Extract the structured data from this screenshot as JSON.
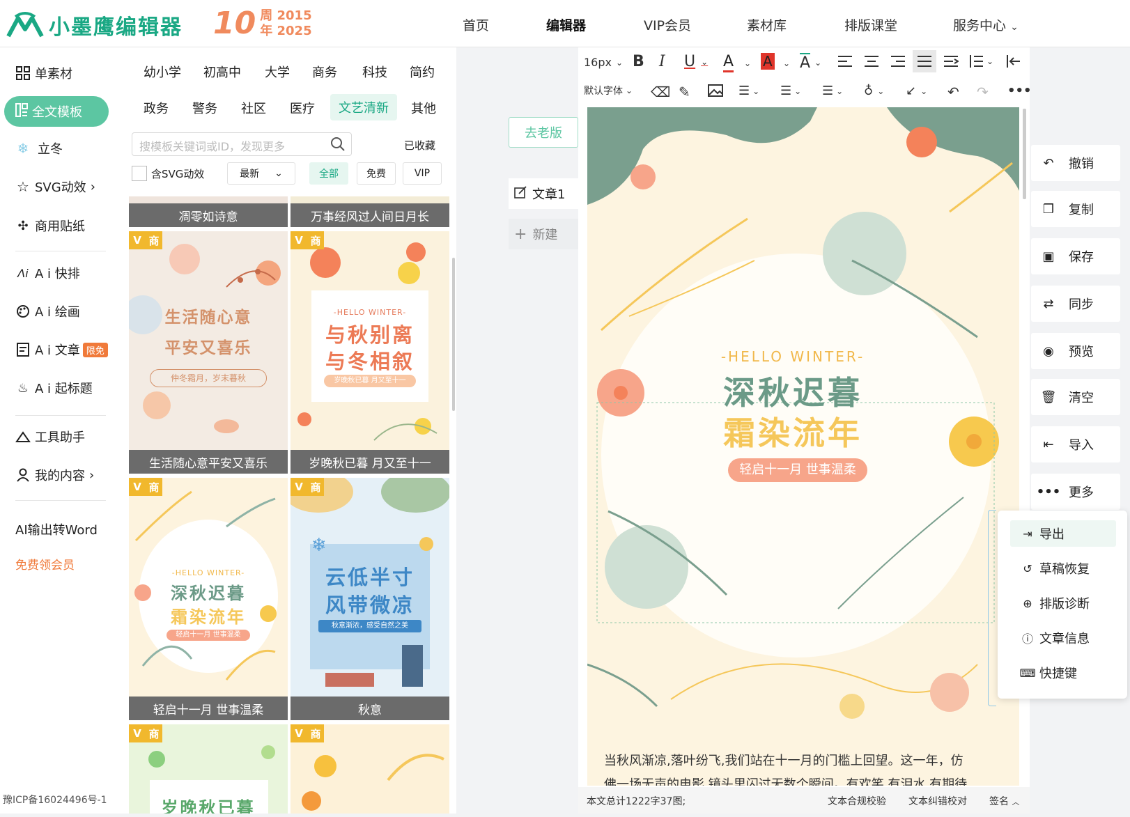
{
  "header": {
    "brand": "小墨鹰编辑器",
    "anniv_num": "10",
    "anniv_line1": "周 2015",
    "anniv_line2": "年 2025",
    "nav": [
      "首页",
      "编辑器",
      "VIP会员",
      "素材库",
      "排版课堂",
      "服务中心"
    ]
  },
  "left_nav": {
    "items": [
      "单素材",
      "全文模板",
      "立冬",
      "SVG动效",
      "商用贴纸",
      "A i 快排",
      "A i 绘画",
      "A i 文章",
      "A i 起标题",
      "工具助手",
      "我的内容",
      "AI输出转Word",
      "免费领会员"
    ],
    "badge": "限免"
  },
  "template_panel": {
    "categories_row1": [
      "幼小学",
      "初高中",
      "大学",
      "商务",
      "科技",
      "简约"
    ],
    "categories_row2": [
      "政务",
      "警务",
      "社区",
      "医疗",
      "文艺清新",
      "其他"
    ],
    "search_placeholder": "搜模板关键词或ID，发现更多",
    "favorites": "已收藏",
    "svg_filter": "含SVG动效",
    "sort": "最新",
    "filters": [
      "全部",
      "免费",
      "VIP"
    ],
    "cards": [
      {
        "caption": "凋零如诗意"
      },
      {
        "caption": "万事经风过人间日月长"
      },
      {
        "caption": "生活随心意平安又喜乐",
        "l1": "生活随心意",
        "l2": "平安又喜乐",
        "sub": "仲冬霜月，岁末暮秋"
      },
      {
        "caption": "岁晚秋已暮 月又至十一",
        "hw": "-HELLO WINTER-",
        "l1": "与秋别离",
        "l2": "与冬相叙",
        "sub": "岁晚秋已暮 月又至十一"
      },
      {
        "caption": "轻启十一月 世事温柔",
        "hw": "-HELLO WINTER-",
        "l1": "深秋迟暮",
        "l2": "霜染流年",
        "sub": "轻启十一月 世事温柔"
      },
      {
        "caption": "秋意",
        "l1": "云低半寸",
        "l2": "风带微凉",
        "sub": "秋意渐浓，感受自然之美"
      },
      {
        "l1": "岁晚秋已暮"
      },
      {}
    ],
    "tag_v": "V",
    "tag_shang": "商"
  },
  "icp": "豫ICP备16024496号-1",
  "middle": {
    "old_version": "去老版",
    "doc_name": "文章1",
    "new_label": "新建"
  },
  "toolbar": {
    "font_size": "16px",
    "font_family": "默认字体"
  },
  "canvas": {
    "hello": "-HELLO WINTER-",
    "title1": "深秋迟暮",
    "title2": "霜染流年",
    "pill": "轻启十一月 世事温柔",
    "para1": "当秋风渐凉,落叶纷飞,我们站在十一月的门槛上回望。这一年，仿",
    "para2": "佛一场无声的电影,镜头里闪过无数个瞬间。有欢笑,有泪水,有期待"
  },
  "status": {
    "count": "本文总计1222字37图;",
    "check1": "文本合规校验",
    "check2": "文本纠错校对",
    "sign": "签名"
  },
  "right_actions": [
    "撤销",
    "复制",
    "保存",
    "同步",
    "预览",
    "清空",
    "导入",
    "更多"
  ],
  "more_menu": [
    "导出",
    "草稿恢复",
    "排版诊断",
    "文章信息",
    "快捷键"
  ],
  "colors": {
    "brand": "#1aa884",
    "accent_green": "#5cc6a2",
    "orange": "#f08a5d",
    "title_green": "#6b9a87",
    "title_yellow": "#f5c75a"
  }
}
